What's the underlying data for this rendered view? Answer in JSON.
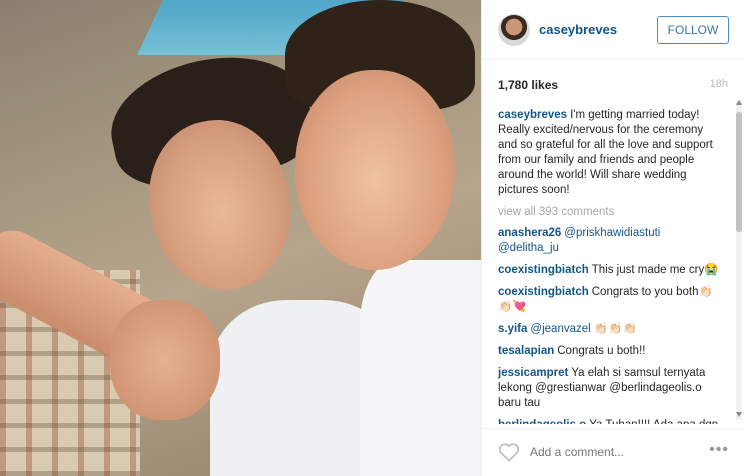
{
  "post": {
    "username": "caseybreves",
    "follow_label": "FOLLOW",
    "likes": "1,780 likes",
    "time": "18h",
    "caption_user": "caseybreves",
    "caption_text": "I'm getting married today! Really excited/nervous for the ceremony and so grateful for all the love and support from our family and friends and people around the world! Will share wedding pictures soon!",
    "view_all": "view all 393 comments",
    "add_comment_placeholder": "Add a comment...",
    "more_label": "•••"
  },
  "comments": [
    {
      "user": "anashera26",
      "mention": "@priskhawidiastuti @delitha_ju",
      "text": ""
    },
    {
      "user": "coexistingbiatch",
      "mention": "",
      "text": "This just made me cry😭"
    },
    {
      "user": "coexistingbiatch",
      "mention": "",
      "text": "Congrats to you both👏🏻👏🏻💘"
    },
    {
      "user": "s.yifa",
      "mention": "@jeanvazel",
      "text": "👏🏻👏🏻👏🏻"
    },
    {
      "user": "tesalapian",
      "mention": "",
      "text": "Congrats u both!!"
    },
    {
      "user": "jessicampret",
      "mention": "",
      "text": "Ya elah si samsul ternyata lekong @grestianwar @berlindageolis.o baru tau"
    },
    {
      "user": "berlindageolis.o",
      "mention": "",
      "text": "Ya Tuhan!!!! Ada apa dgn dunia ini!!!! @jessicampret"
    }
  ],
  "icons": {
    "heart": "heart-icon",
    "avatar": "avatar"
  },
  "colors": {
    "username": "#125688",
    "follow_border": "#4e8cc6",
    "muted": "#a5a7aa"
  }
}
